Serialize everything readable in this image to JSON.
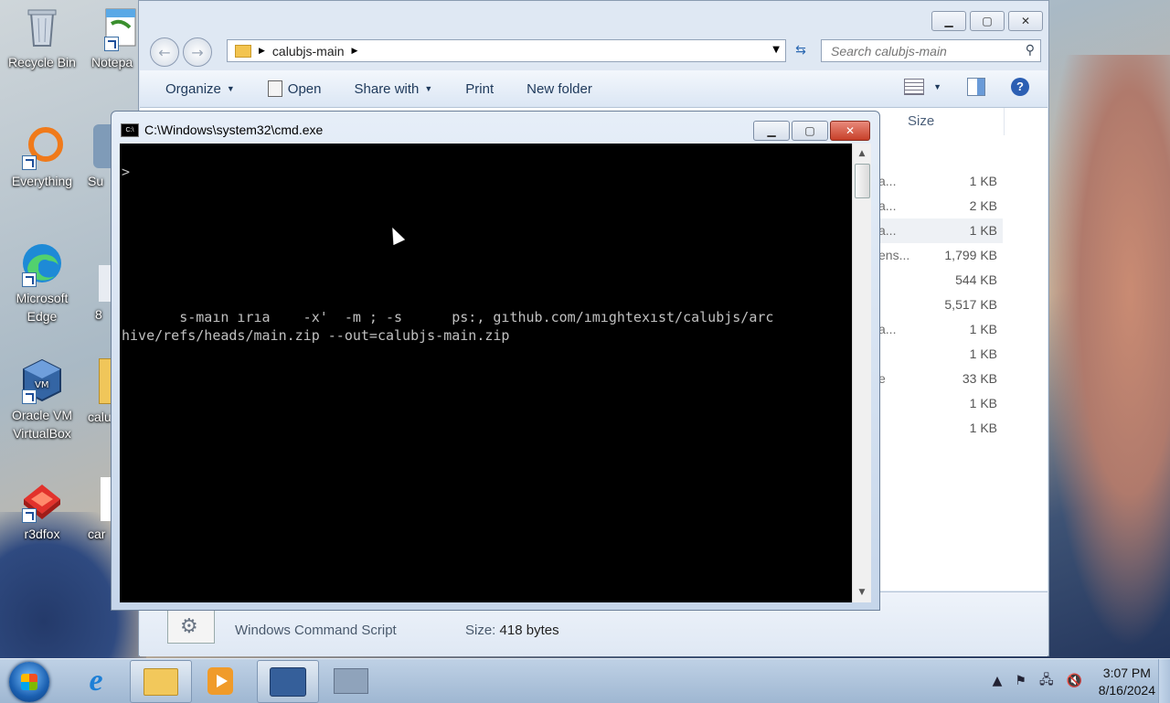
{
  "desktop": {
    "icons": [
      {
        "label": "Recycle Bin"
      },
      {
        "label": "Notepa"
      },
      {
        "label": "Everything"
      },
      {
        "label": "Su"
      },
      {
        "label": "Microsoft Edge"
      },
      {
        "label": "8"
      },
      {
        "label": "Oracle VM VirtualBox"
      },
      {
        "label": "calu"
      },
      {
        "label": "r3dfox"
      },
      {
        "label": "car"
      }
    ]
  },
  "explorer": {
    "breadcrumb": "calubjs-main",
    "search_placeholder": "Search calubjs-main",
    "toolbar": {
      "organize": "Organize",
      "open": "Open",
      "share_with": "Share with",
      "print": "Print",
      "new_folder": "New folder"
    },
    "column_size": "Size",
    "files": [
      {
        "name": "a...",
        "size": "1 KB",
        "selected": false
      },
      {
        "name": "a...",
        "size": "2 KB",
        "selected": false
      },
      {
        "name": "a...",
        "size": "1 KB",
        "selected": true
      },
      {
        "name": "ens...",
        "size": "1,799 KB",
        "selected": false
      },
      {
        "name": "",
        "size": "544 KB",
        "selected": false
      },
      {
        "name": "",
        "size": "5,517 KB",
        "selected": false
      },
      {
        "name": "a...",
        "size": "1 KB",
        "selected": false
      },
      {
        "name": "",
        "size": "1 KB",
        "selected": false
      },
      {
        "name": "e",
        "size": "33 KB",
        "selected": false
      },
      {
        "name": "",
        "size": "1 KB",
        "selected": false
      },
      {
        "name": "",
        "size": "1 KB",
        "selected": false
      }
    ],
    "details": {
      "type": "Windows Command Script",
      "size_label": "Size:",
      "size_value": "418 bytes"
    }
  },
  "cmd": {
    "title": "C:\\Windows\\system32\\cmd.exe",
    "prompt": ">",
    "line1": "       s-maın ırıa    -x'  -m ; -s      ps:, gıthub.com/ımıghtexıst/calubjs/arc",
    "line2": "hive/refs/heads/main.zip --out=calubjs-main.zip"
  },
  "taskbar": {
    "time": "3:07 PM",
    "date": "8/16/2024"
  }
}
